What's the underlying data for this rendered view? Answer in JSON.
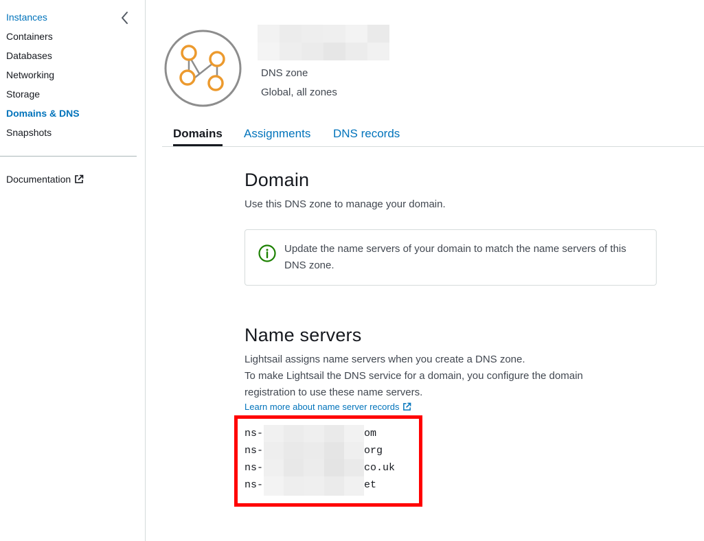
{
  "sidebar": {
    "items": [
      {
        "label": "Instances",
        "state": "link"
      },
      {
        "label": "Containers",
        "state": "normal"
      },
      {
        "label": "Databases",
        "state": "normal"
      },
      {
        "label": "Networking",
        "state": "normal"
      },
      {
        "label": "Storage",
        "state": "normal"
      },
      {
        "label": "Domains & DNS",
        "state": "active"
      },
      {
        "label": "Snapshots",
        "state": "normal"
      }
    ],
    "documentation_label": "Documentation",
    "collapse_icon": "chevron-left-icon"
  },
  "zone": {
    "icon": "dns-zone-nodes-icon",
    "name_redacted": "",
    "type": "DNS zone",
    "scope": "Global, all zones"
  },
  "tabs": [
    {
      "label": "Domains",
      "active": true
    },
    {
      "label": "Assignments",
      "active": false
    },
    {
      "label": "DNS records",
      "active": false
    }
  ],
  "domain_section": {
    "title": "Domain",
    "description": "Use this DNS zone to manage your domain.",
    "info_message": "Update the name servers of your domain to match the name servers of this DNS zone.",
    "info_icon": "info-circle-icon"
  },
  "name_servers_section": {
    "title": "Name servers",
    "lines": [
      "Lightsail assigns name servers when you create a DNS zone.",
      "To make Lightsail the DNS service for a domain, you configure the domain",
      "registration to use these name servers."
    ],
    "learn_more_label": "Learn more about name server records",
    "servers": [
      {
        "prefix": "ns-",
        "suffix": "om"
      },
      {
        "prefix": "ns-",
        "suffix": "org"
      },
      {
        "prefix": "ns-",
        "suffix": "co.uk"
      },
      {
        "prefix": "ns-",
        "suffix": "et"
      }
    ]
  },
  "colors": {
    "link": "#0073bb",
    "text": "#16191f",
    "secondary_text": "#414750",
    "border": "#d5dbdb",
    "highlight": "#ff0000",
    "icon_orange": "#ec9a2e",
    "icon_ring": "#8d8d8d",
    "info_green": "#1d8102"
  }
}
